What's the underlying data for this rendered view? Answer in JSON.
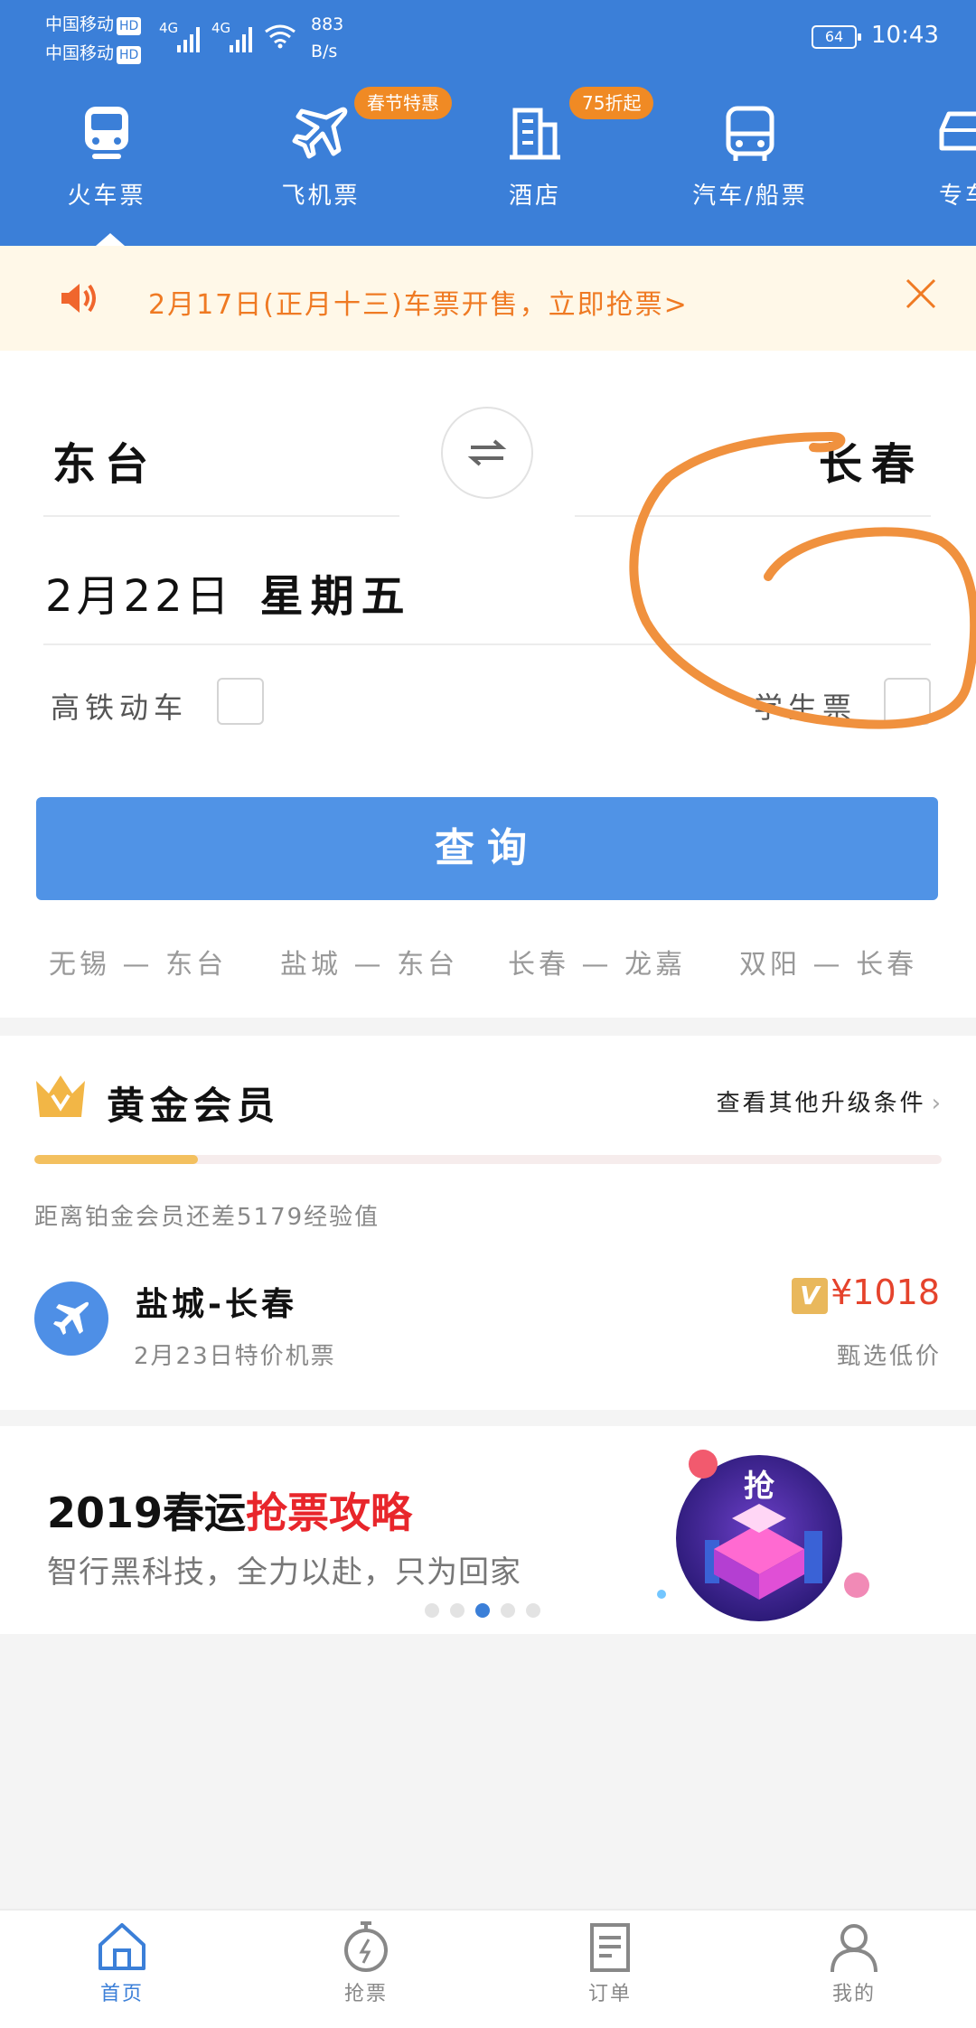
{
  "status_bar": {
    "carrier1": "中国移动",
    "carrier2": "中国移动",
    "hd": "HD",
    "net1": "4G",
    "net2": "4G",
    "speed_value": "883",
    "speed_unit": "B/s",
    "battery": "64",
    "time": "10:43"
  },
  "nav": {
    "items": [
      {
        "label": "火车票",
        "icon": "train-icon"
      },
      {
        "label": "飞机票",
        "icon": "plane-icon",
        "badge": "春节特惠"
      },
      {
        "label": "酒店",
        "icon": "hotel-icon",
        "badge": "75折起"
      },
      {
        "label": "汽车/船票",
        "icon": "bus-icon"
      },
      {
        "label": "专车",
        "icon": "car-icon"
      }
    ]
  },
  "notice": {
    "text": "2月17日(正月十三)车票开售，立即抢票>"
  },
  "search": {
    "from": "东台",
    "to": "长春",
    "date": "2月22日",
    "weekday": "星期五",
    "option_highspeed": "高铁动车",
    "option_student": "学生票",
    "query_button": "查询",
    "recent": [
      "无锡 — 东台",
      "盐城 — 东台",
      "长春 — 龙嘉",
      "双阳 — 长春"
    ]
  },
  "member": {
    "title": "黄金会员",
    "link": "查看其他升级条件",
    "progress_fraction": 0.18,
    "gap_text": "距离铂金会员还差5179经验值",
    "deal_route": "盐城-长春",
    "deal_sub": "2月23日特价机票",
    "deal_badge": "V",
    "deal_price": "¥1018",
    "deal_tag": "甄选低价"
  },
  "banner": {
    "title_black": "2019春运",
    "title_red": "抢票攻略",
    "subtitle": "智行黑科技，全力以赴，只为回家",
    "art_char": "抢",
    "active_dot": 2,
    "dots": 5
  },
  "tabs": [
    {
      "label": "首页",
      "icon": "home-icon"
    },
    {
      "label": "抢票",
      "icon": "stopwatch-icon"
    },
    {
      "label": "订单",
      "icon": "order-icon"
    },
    {
      "label": "我的",
      "icon": "user-icon"
    }
  ],
  "colors": {
    "brand_blue": "#3b7fd8",
    "button_blue": "#5093e6",
    "accent_orange": "#f08a24",
    "price_red": "#e5432c",
    "annotation_orange": "#f0913e"
  }
}
